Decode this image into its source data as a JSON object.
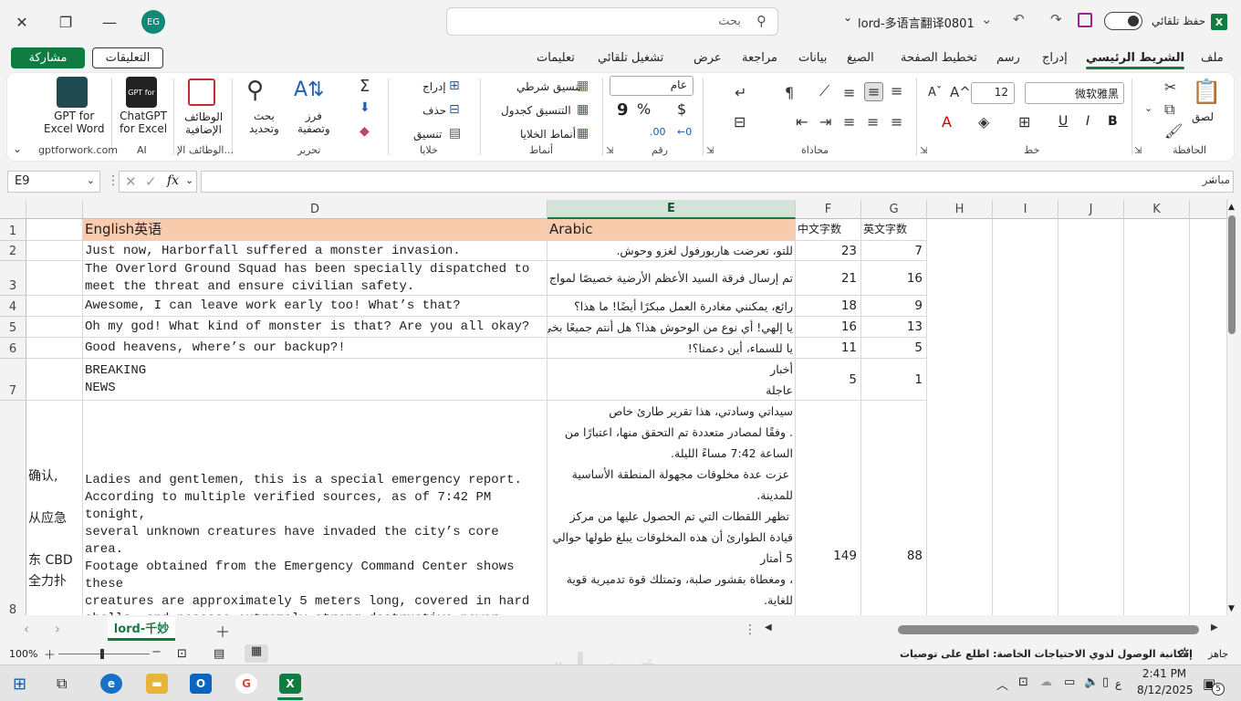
{
  "window": {
    "avatar_initials": "EG",
    "search_placeholder": "بحث",
    "file_name": "lord-多语言翻译0801",
    "autosave_label": "حفظ تلقائي",
    "excel_logo": "X"
  },
  "tabs": [
    "ملف",
    "الشريط الرئيسي",
    "إدراج",
    "رسم",
    "تخطيط الصفحة",
    "الصيغ",
    "بيانات",
    "مراجعة",
    "عرض",
    "تشغيل تلقائي",
    "تعليمات"
  ],
  "share_label": "مشاركة",
  "comments_label": "التعليقات",
  "ribbon": {
    "clipboard": {
      "label": "الحافظة",
      "paste": "لصق"
    },
    "font": {
      "label": "خط",
      "name": "微软雅黑",
      "size": "12",
      "bold": "B",
      "italic": "I",
      "underline": "U"
    },
    "alignment": {
      "label": "محاذاة"
    },
    "number": {
      "label": "رقم",
      "format": "عام",
      "currency": "$",
      "percent": "%",
      "comma": "9"
    },
    "styles": {
      "label": "أنماط",
      "conditional": "تنسيق شرطي",
      "as_table": "التنسيق كجدول",
      "cell_styles": "أنماط الخلايا"
    },
    "cells": {
      "label": "خلايا",
      "insert": "إدراج",
      "delete": "حذف",
      "format": "تنسيق"
    },
    "editing": {
      "label": "تحرير",
      "sort": "فرز\nوتصفية",
      "find": "بحث\nوتحديد"
    },
    "addins": {
      "label": "الوظائف الإ...",
      "button": "الوظائف\nالإضافية"
    },
    "ai": {
      "label": "AI",
      "chatgpt": "ChatGPT\nfor Excel",
      "chatgpt_icon_text": "GPT for"
    },
    "gptforwork": {
      "label": "gptforwork.com",
      "button": "GPT for\nExcel Word"
    }
  },
  "formula_bar": {
    "name_box": "E9",
    "fx": "fx",
    "mode": "مباشر"
  },
  "columns": [
    "D",
    "E",
    "F",
    "G",
    "H",
    "I",
    "J",
    "K"
  ],
  "rows": [
    {
      "num": "1",
      "C": "",
      "D": "English英语",
      "E": "Arabic",
      "F": "中文字数",
      "G": "英文字数"
    },
    {
      "num": "2",
      "C": "",
      "D": "Just now, Harborfall suffered a monster invasion.",
      "E": "للتو، تعرضت هاربورفول لغزو وحوش.",
      "F": "23",
      "G": "7"
    },
    {
      "num": "3",
      "C": "",
      "D": "The Overlord Ground Squad has been specially dispatched to\nmeet the threat and ensure civilian safety.",
      "E": "تم إرسال فرقة السيد الأعظم الأرضية خصيصًا لمواج",
      "F": "21",
      "G": "16"
    },
    {
      "num": "4",
      "C": "",
      "D": "Awesome, I can leave work early too! What’s that?",
      "E": "رائع، يمكنني مغادرة العمل مبكرًا أيضًا! ما هذا؟",
      "F": "18",
      "G": "9"
    },
    {
      "num": "5",
      "C": "",
      "D": "Oh my god! What kind of monster is that? Are you all okay?",
      "E": "يا إلهي! أي نوع من الوحوش هذا؟ هل أنتم جميعًا بخي",
      "F": "16",
      "G": "13"
    },
    {
      "num": "6",
      "C": "",
      "D": "Good heavens, where’s our backup?!",
      "E": "يا للسماء، أين دعمنا؟!",
      "F": "11",
      "G": "5"
    },
    {
      "num": "7",
      "C": "",
      "D": "BREAKING\nNEWS",
      "E": "أخبار\nعاجلة",
      "F": "5",
      "G": "1"
    },
    {
      "num": "8",
      "C": "确认,\n\n从应急\n\n东 CBD\n全力扑",
      "D": "Ladies and gentlemen, this is a special emergency report.\nAccording to multiple verified sources, as of 7:42 PM tonight,\nseveral unknown creatures have invaded the city’s core area.\nFootage obtained from the Emergency Command Center shows these\ncreatures are approximately 5 meters long, covered in hard\nshells, and possess extremely strong destructive power. Three\noffice buildings in the East City CBD have partially collapsed\ndue to impacts, and the fire department is making full efforts",
      "E": "سيداتي وسادتي، هذا تقرير طارئ خاص\n. وفقًا لمصادر متعددة تم التحقق منها، اعتبارًا من\nالساعة 7:42 مساءً الليلة.\n عزت عدة مخلوقات مجهولة المنطقة الأساسية\nللمدينة.\n تظهر اللقطات التي تم الحصول عليها من مركز\nقيادة الطوارئ أن هذه المخلوقات يبلغ طولها حوالي\n5 أمتار\n، ومغطاة بقشور صلبة، وتمتلك قوة تدميرية قوية\nللغاية.",
      "F": "149",
      "G": "88"
    }
  ],
  "sheet_tab": "lord-千妙",
  "status": {
    "ready": "جاهز",
    "accessibility": "إمكانية الوصول لذوي الاحتياجات الخاصة: اطلع على توصيات",
    "zoom": "100%",
    "watermark": "خمسات"
  },
  "taskbar": {
    "time": "2:41 PM",
    "date": "8/12/2025",
    "lang": "ع",
    "notif_count": "5"
  }
}
